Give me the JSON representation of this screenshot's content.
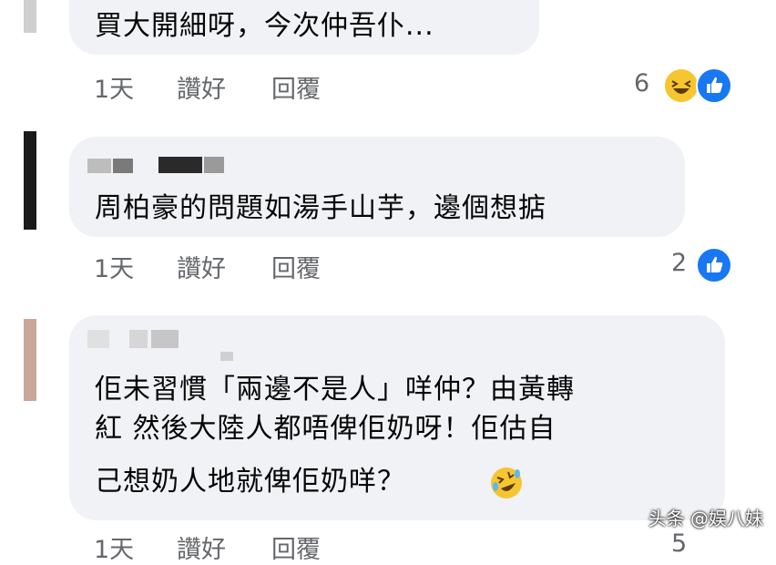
{
  "comments": [
    {
      "lines": [
        "買大開細呀，今次仲吾仆..."
      ],
      "time": "1天",
      "like_label": "讚好",
      "reply_label": "回覆",
      "reaction_count": "6",
      "reactions": [
        "laugh-icon",
        "like-icon"
      ]
    },
    {
      "lines": [
        "周柏豪的問題如湯手山芋，邊個想掂"
      ],
      "time": "1天",
      "like_label": "讚好",
      "reply_label": "回覆",
      "reaction_count": "2",
      "reactions": [
        "like-icon"
      ]
    },
    {
      "lines": [
        "佢未習慣「兩邊不是人」咩仲？由黃轉",
        "紅 然後大陸人都唔俾佢奶呀！佢估自",
        "己想奶人地就俾佢奶咩？"
      ],
      "time": "1天",
      "like_label": "讚好",
      "reply_label": "回覆",
      "reaction_count": "5",
      "reactions": [
        "rofl-emoji"
      ]
    }
  ],
  "watermark": "头条 @娱八妹",
  "colors": {
    "bubble": "#f0f2f5",
    "text": "#050505",
    "meta": "#65676b",
    "like_blue": "#1877f2",
    "laugh_yellow": "#f7c531"
  }
}
